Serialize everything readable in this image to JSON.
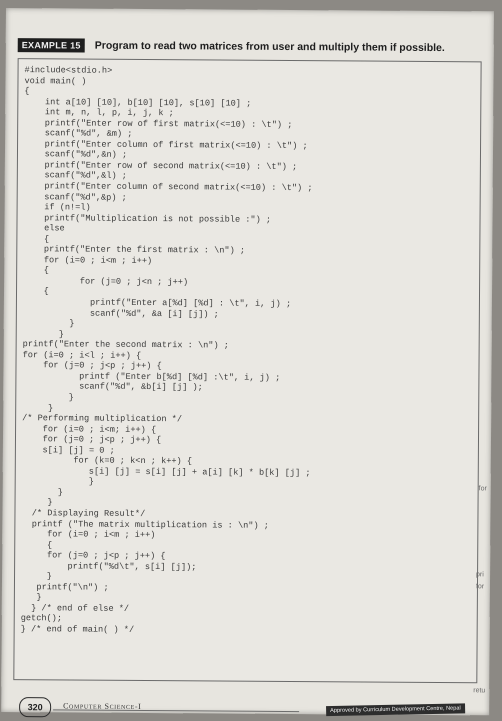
{
  "example": {
    "badge": "EXAMPLE 15",
    "title": "Program to read two matrices from user and multiply them if possible."
  },
  "code_lines": [
    "#include<stdio.h>",
    "void main( )",
    "{",
    "    int a[10] [10], b[10] [10], s[10] [10] ;",
    "    int m, n, l, p, i, j, k ;",
    "    printf(\"Enter row of first matrix(<=10) : \\t\") ;",
    "    scanf(\"%d\", &m) ;",
    "    printf(\"Enter column of first matrix(<=10) : \\t\") ;",
    "    scanf(\"%d\",&n) ;",
    "    printf(\"Enter row of second matrix(<=10) : \\t\") ;",
    "    scanf(\"%d\",&l) ;",
    "    printf(\"Enter column of second matrix(<=10) : \\t\") ;",
    "    scanf(\"%d\",&p) ;",
    "    if (n!=l)",
    "    printf(\"Multiplication is not possible :\") ;",
    "    else",
    "    {",
    "    printf(\"Enter the first matrix : \\n\") ;",
    "    for (i=0 ; i<m ; i++)",
    "    {",
    "           for (j=0 ; j<n ; j++)",
    "    {",
    "             printf(\"Enter a[%d] [%d] : \\t\", i, j) ;",
    "             scanf(\"%d\", &a [i] [j]) ;",
    "         }",
    "       }",
    "printf(\"Enter the second matrix : \\n\") ;",
    "for (i=0 ; i<l ; i++) {",
    "    for (j=0 ; j<p ; j++) {",
    "           printf (\"Enter b[%d] [%d] :\\t\", i, j) ;",
    "           scanf(\"%d\", &b[i] [j] );",
    "         }",
    "     }",
    "/* Performing multiplication */",
    "    for (i=0 ; i<m; i++) {",
    "    for (j=0 ; j<p ; j++) {",
    "    s[i] [j] = 0 ;",
    "          for (k=0 ; k<n ; k++) {",
    "             s[i] [j] = s[i] [j] + a[i] [k] * b[k] [j] ;",
    "             }",
    "       }",
    "     }",
    "  /* Displaying Result*/",
    "  printf (\"The matrix multiplication is : \\n\") ;",
    "     for (i=0 ; i<m ; i++)",
    "     {",
    "     for (j=0 ; j<p ; j++) {",
    "         printf(\"%d\\t\", s[i] [j]);",
    "     }",
    "   printf(\"\\n\") ;",
    "   }",
    "  } /* end of else */",
    "getch();",
    "} /* end of main( ) */"
  ],
  "footer": {
    "page_number": "320",
    "book_title": "Computer Science-I",
    "approval": "Approved by Curriculum Development Centre, Nepal"
  },
  "edge_marks": [
    "for",
    "pri",
    "for",
    "retu"
  ]
}
